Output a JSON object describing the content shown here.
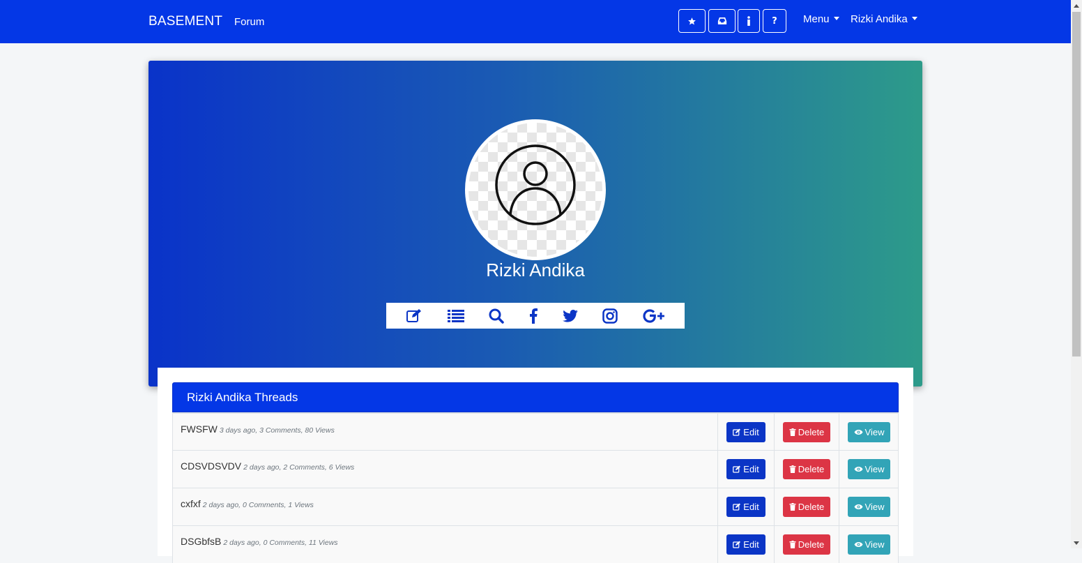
{
  "navbar": {
    "brand": "BASEMENT",
    "forum_link": "Forum",
    "icon_buttons": [
      "star-icon",
      "inbox-icon",
      "info-icon",
      "question-icon"
    ],
    "menu_label": "Menu",
    "user_label": "Rizki Andika"
  },
  "profile": {
    "name": "Rizki Andika",
    "social_icons": [
      "edit-icon",
      "list-icon",
      "search-icon",
      "facebook-icon",
      "twitter-icon",
      "instagram-icon",
      "google-plus-icon"
    ]
  },
  "threads": {
    "header": "Rizki Andika Threads",
    "edit_label": "Edit",
    "delete_label": "Delete",
    "view_label": "View",
    "rows": [
      {
        "title": "FWSFW",
        "meta": "3 days ago, 3 Comments, 80 Views"
      },
      {
        "title": "CDSVDSVDV",
        "meta": "2 days ago, 2 Comments, 6 Views"
      },
      {
        "title": "cxfxf",
        "meta": "2 days ago, 0 Comments, 1 Views"
      },
      {
        "title": "DSGbfsB",
        "meta": "2 days ago, 0 Comments, 11 Views"
      }
    ]
  },
  "colors": {
    "navbar": "#0437e6",
    "hero_start": "#0a33c9",
    "hero_end": "#2d9b8a",
    "edit": "#0b35c6",
    "delete": "#dc3545",
    "view": "#32a4b7"
  }
}
